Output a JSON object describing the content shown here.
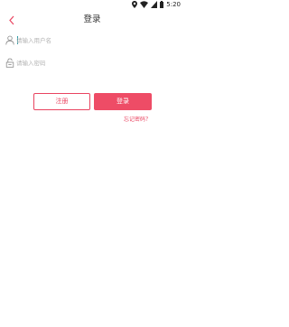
{
  "status_bar": {
    "time": "5:20"
  },
  "header": {
    "title": "登录",
    "back_icon": "chevron-left-icon"
  },
  "form": {
    "username_placeholder": "请输入用户名",
    "username_value": "",
    "username_icon": "user-icon",
    "password_placeholder": "请输入密码",
    "password_value": "",
    "password_icon": "lock-icon"
  },
  "actions": {
    "register_label": "注册",
    "login_label": "登录",
    "forgot_label": "忘记密码？"
  },
  "colors": {
    "accent": "#ee4c66",
    "cursor": "#2e9aa6"
  }
}
